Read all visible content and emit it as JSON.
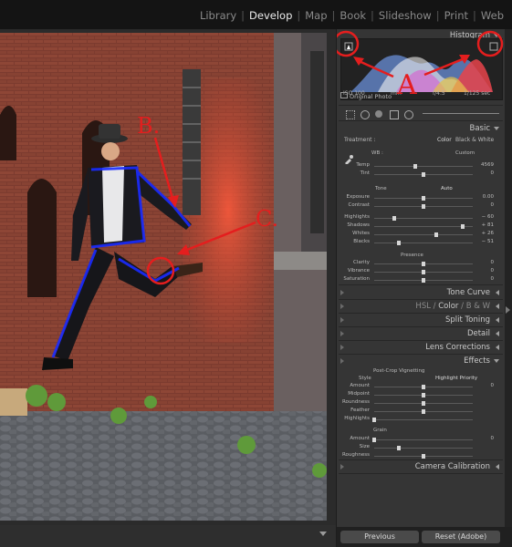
{
  "modules": [
    "Library",
    "Develop",
    "Map",
    "Book",
    "Slideshow",
    "Print",
    "Web"
  ],
  "active_module": "Develop",
  "histogram": {
    "title": "Histogram",
    "iso": "ISO 100",
    "mm": "mm",
    "aperture": "f/4.5",
    "shutter": "1/125 sec",
    "original_photo": "Original Photo"
  },
  "basic": {
    "title": "Basic",
    "treatment_label": "Treatment :",
    "color": "Color",
    "bw": "Black & White",
    "wb_label": "WB :",
    "wb_value": "Custom",
    "temp": {
      "label": "Temp",
      "value": "4569",
      "level": 0.42
    },
    "tint": {
      "label": "Tint",
      "value": "0",
      "level": 0.5
    },
    "tone_label": "Tone",
    "auto": "Auto",
    "exposure": {
      "label": "Exposure",
      "value": "0.00",
      "level": 0.5
    },
    "contrast": {
      "label": "Contrast",
      "value": "0",
      "level": 0.5
    },
    "highlights": {
      "label": "Highlights",
      "value": "− 60",
      "level": 0.2
    },
    "shadows": {
      "label": "Shadows",
      "value": "+ 81",
      "level": 0.9
    },
    "whites": {
      "label": "Whites",
      "value": "+ 26",
      "level": 0.63
    },
    "blacks": {
      "label": "Blacks",
      "value": "− 51",
      "level": 0.25
    },
    "presence_label": "Presence",
    "clarity": {
      "label": "Clarity",
      "value": "0",
      "level": 0.5
    },
    "vibrance": {
      "label": "Vibrance",
      "value": "0",
      "level": 0.5
    },
    "saturation": {
      "label": "Saturation",
      "value": "0",
      "level": 0.5
    }
  },
  "panels": {
    "tone_curve": "Tone Curve",
    "hsl": "HSL",
    "color": "Color",
    "bw": "B & W",
    "split_toning": "Split Toning",
    "detail": "Detail",
    "lens_corrections": "Lens Corrections",
    "effects": "Effects",
    "camera_calibration": "Camera Calibration"
  },
  "effects": {
    "vignette_title": "Post-Crop Vignetting",
    "style_label": "Style",
    "style_value": "Highlight Priority",
    "amount": {
      "label": "Amount",
      "value": "0",
      "level": 0.5
    },
    "midpoint": {
      "label": "Midpoint",
      "value": "",
      "level": 0.5
    },
    "roundness": {
      "label": "Roundness",
      "value": "",
      "level": 0.5
    },
    "feather": {
      "label": "Feather",
      "value": "",
      "level": 0.5
    },
    "highlights": {
      "label": "Highlights",
      "value": "",
      "level": 0.0
    },
    "grain_title": "Grain",
    "grain_amount": {
      "label": "Amount",
      "value": "0",
      "level": 0.0
    },
    "grain_size": {
      "label": "Size",
      "value": "",
      "level": 0.25
    },
    "grain_roughness": {
      "label": "Roughness",
      "value": "",
      "level": 0.5
    }
  },
  "footer": {
    "previous": "Previous",
    "reset": "Reset (Adobe)"
  },
  "annotations": {
    "a": "A",
    "b": "B.",
    "c": "C."
  },
  "colors": {
    "annotation": "#e41e1e",
    "brick": "#7a3a2e",
    "clipping_blue": "#1a2bff"
  }
}
